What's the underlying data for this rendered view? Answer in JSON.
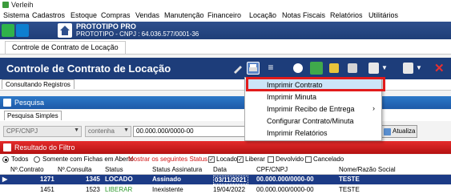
{
  "window": {
    "title": "Verleih"
  },
  "menu": [
    "Sistema",
    "Cadastros",
    "Estoque",
    "Compras",
    "Vendas",
    "Manutenção",
    "Financeiro",
    "Locação",
    "Notas Fiscais",
    "Relatórios",
    "Utilitários"
  ],
  "banner": {
    "company": "PROTOTIPO PRO",
    "subtitle": "PROTOTIPO - CNPJ : 64.036.577/0001-36"
  },
  "tabs": {
    "active": "Controle de Contrato de Locação"
  },
  "toolbar": {
    "title": "Controle de Contrato de Locação"
  },
  "subtab": "Consultando Registros",
  "search": {
    "section_label": "Pesquisa",
    "mode_tab": "Pesquisa Simples",
    "field": "CPF/CNPJ",
    "operator": "contenha",
    "value": "00.000.000/0000-00",
    "refresh_label": "Atualiza"
  },
  "result": {
    "section_label": "Resultado do Filtro",
    "filter": {
      "all": "Todos",
      "open_only": "Somente com Fichas em Aberto",
      "show_status": "Mostrar os seguintes Status :",
      "status_options": [
        "Locado",
        "Liberar",
        "Devolvido",
        "Cancelado"
      ]
    },
    "columns": [
      "Nº.Contrato",
      "Nº.Consulta",
      "Status",
      "Status Assinatura",
      "Data",
      "CPF/CNPJ",
      "Nome/Razão Social"
    ],
    "rows": [
      [
        "1271",
        "1345",
        "LOCADO",
        "Assinado",
        "03/11/2021",
        "00.000.000/0000-00",
        "TESTE"
      ],
      [
        "1451",
        "1523",
        "LIBERAR",
        "Inexistente",
        "19/04/2022",
        "00.000.000/0000-00",
        "TESTE"
      ]
    ]
  },
  "popup_menu": {
    "items": [
      "Imprimir Contrato",
      "Imprimir Minuta",
      "Imprimir Recibo de Entrega",
      "Configurar Contrato/Minuta",
      "Imprimir Relatórios"
    ],
    "submenu_marker": "›"
  },
  "colors": {
    "toolbar_bg": "#1d3d7a",
    "section_blue": "#2c78c8",
    "section_red": "#e42b2b",
    "highlight_border": "#e21b1b",
    "status_liberar": "#2e9a2e",
    "mostrar_text": "#d01010"
  }
}
